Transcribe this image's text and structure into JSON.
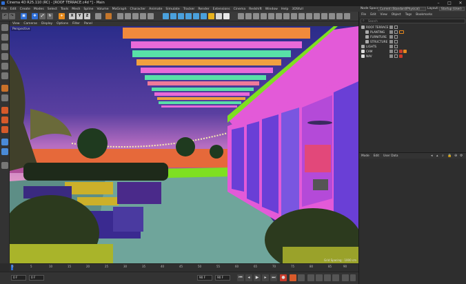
{
  "window": {
    "title": "Cinema 4D R25.110 (RC) - [ROOF TERRACE.c4d *] - Main",
    "minimize": "–",
    "maximize": "□",
    "close": "✕"
  },
  "menu": [
    "File",
    "Edit",
    "Create",
    "Modes",
    "Select",
    "Tools",
    "Mesh",
    "Spline",
    "Volume",
    "MoGraph",
    "Character",
    "Animate",
    "Simulate",
    "Tracker",
    "Render",
    "Extensions",
    "Cinema",
    "Redshift",
    "Window",
    "Help",
    "3DSfull"
  ],
  "node_space": {
    "label": "Node Space:",
    "value": "Current (Standard/Physical)",
    "layout_label": "Layout:",
    "layout_value": "Startup (User)"
  },
  "toolbar": {
    "axis_x": "X",
    "axis_y": "Y",
    "axis_z": "Z"
  },
  "viewport": {
    "menu": [
      "View",
      "Cameras",
      "Display",
      "Options",
      "Filter",
      "Panel"
    ],
    "camera_label": "Perspective",
    "grid_info": "Grid Spacing : 1000 cm"
  },
  "timeline": {
    "ticks": [
      "0",
      "5",
      "10",
      "15",
      "20",
      "25",
      "30",
      "35",
      "40",
      "45",
      "50",
      "55",
      "60",
      "65",
      "70",
      "75",
      "80",
      "85",
      "90"
    ],
    "end_label": "0 F"
  },
  "playback": {
    "current_frame": "0 F",
    "start_frame": "0 F",
    "end_frame": "90 F",
    "max_frame": "90 F"
  },
  "object_manager": {
    "menu": [
      "File",
      "Edit",
      "View",
      "Object",
      "Tags",
      "Bookmarks"
    ],
    "search_placeholder": "Search",
    "objects": [
      {
        "name": "ROOF TERRACE",
        "indent": 0
      },
      {
        "name": "PLANTING",
        "indent": 1
      },
      {
        "name": "FURNITURE",
        "indent": 1
      },
      {
        "name": "STRUCTURE",
        "indent": 1
      },
      {
        "name": "LIGHTS",
        "indent": 0
      },
      {
        "name": "CAM",
        "indent": 0
      },
      {
        "name": "NAV",
        "indent": 0
      }
    ]
  },
  "attribute_manager": {
    "menu": [
      "Mode",
      "Edit",
      "User Data"
    ]
  },
  "colors": {
    "accent": "#2f6fd6",
    "viewport_sky": "#3a2f86",
    "floor": "#6fa59b",
    "magenta_wall": "#e35ad8",
    "purple_glass": "#6a3fd6",
    "lime_trim": "#7ee021"
  }
}
